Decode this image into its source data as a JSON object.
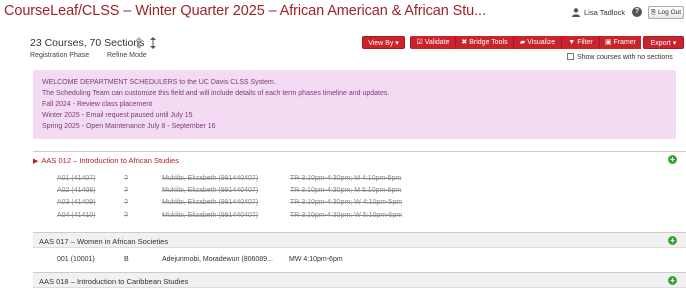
{
  "header": {
    "title": "CourseLeaf/CLSS – Winter Quarter 2025 – African American & African Stu...",
    "user": "Lisa Tadlock",
    "logout": "Log Out",
    "help": "?"
  },
  "summary": {
    "counts": "23 Courses, 70 Sections",
    "phase": "Registration Phase",
    "mode": "Refine Mode"
  },
  "toolbar": {
    "view_by": "View By ▾",
    "validate": "Validate",
    "bridge_tools": "Bridge Tools",
    "visualize": "Visualize",
    "filter": "Filter",
    "framer": "Framer",
    "export": "Export ▾"
  },
  "options": {
    "show_no_sections": "Show courses with no sections"
  },
  "notice": {
    "lines": [
      "WELCOME DEPARTMENT SCHEDULERS to the UC Davis CLSS System.",
      "The Scheduling Team can customize this field and will include details of each term phases timeline and updates.",
      "Fall 2024 - Review class placement",
      "Winter 2025 - Email request paused until July 15",
      "Spring 2025 - Open Maintenance July 8 - September 16"
    ]
  },
  "courses": [
    {
      "title": "AAS 012 – Introduction to African Studies",
      "sections": [
        {
          "sec": "A01 (41407)",
          "type": "?",
          "instructor": "Muklibi, Elizabeth (991440407)",
          "time": "TR 3:10pm-4:30pm; M 4:10pm-5pm"
        },
        {
          "sec": "A02 (41408)",
          "type": "?",
          "instructor": "Muklibi, Elizabeth (991440407)",
          "time": "TR 3:10pm-4:30pm; M 5:10pm-6pm"
        },
        {
          "sec": "A03 (41409)",
          "type": "?",
          "instructor": "Muklibi, Elizabeth (991440407)",
          "time": "TR 3:10pm-4:30pm; W 4:10pm-5pm"
        },
        {
          "sec": "A04 (41410)",
          "type": "?",
          "instructor": "Muklibi, Elizabeth (991440407)",
          "time": "TR 3:10pm-4:30pm; W 5:10pm-6pm"
        }
      ]
    },
    {
      "title": "AAS 017 – Women in African Societies",
      "sections": [
        {
          "sec": "001 (10001)",
          "type": "B",
          "instructor": "Adejunmobi, Moradewun (806089...",
          "time": "MW 4:10pm-6pm"
        }
      ]
    },
    {
      "title": "AAS 018 – Introduction to Caribbean Studies",
      "sections": []
    }
  ],
  "colors": {
    "brand_red": "#c9242b",
    "notice_bg": "#f3dcf3",
    "notice_text": "#7a3a7a",
    "add_green": "#3aa33a"
  }
}
